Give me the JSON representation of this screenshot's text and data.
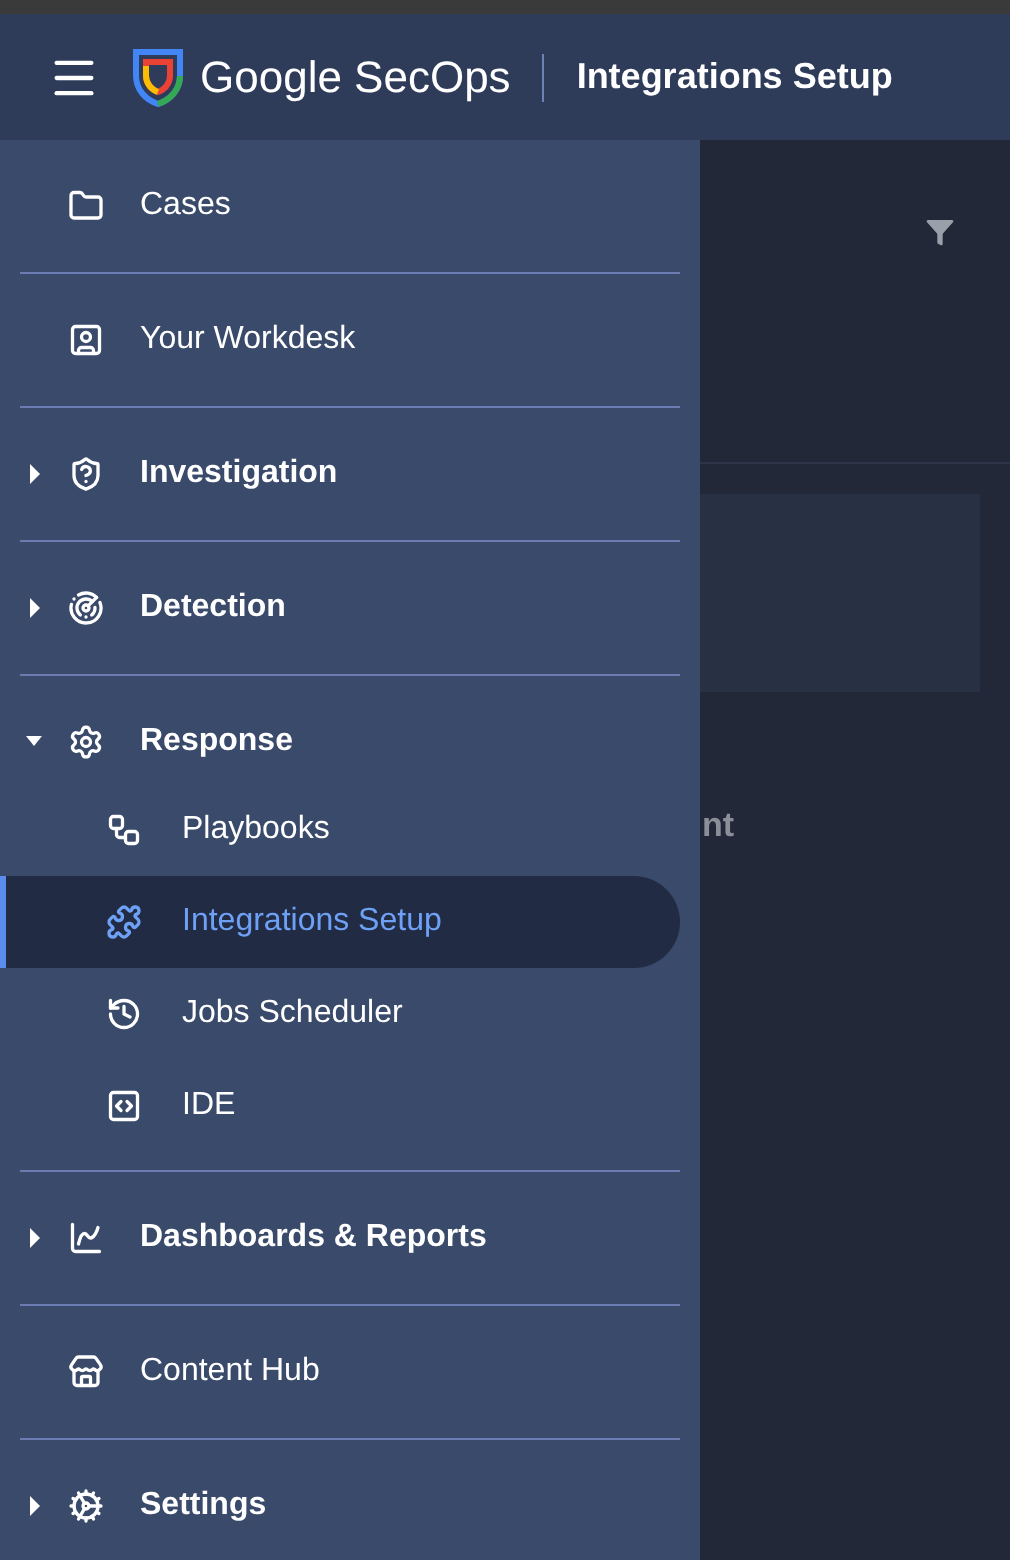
{
  "header": {
    "brand": "Google SecOps",
    "page_title": "Integrations Setup"
  },
  "main": {
    "partial_text": "nt"
  },
  "sidebar": {
    "items": [
      {
        "kind": "link",
        "label": "Cases"
      },
      {
        "kind": "link",
        "label": "Your Workdesk"
      },
      {
        "kind": "group",
        "label": "Investigation",
        "expanded": false
      },
      {
        "kind": "group",
        "label": "Detection",
        "expanded": false
      },
      {
        "kind": "group",
        "label": "Response",
        "expanded": true,
        "children": [
          {
            "label": "Playbooks",
            "selected": false
          },
          {
            "label": "Integrations Setup",
            "selected": true
          },
          {
            "label": "Jobs Scheduler",
            "selected": false
          },
          {
            "label": "IDE",
            "selected": false
          }
        ]
      },
      {
        "kind": "group",
        "label": "Dashboards & Reports",
        "expanded": false
      },
      {
        "kind": "link",
        "label": "Content Hub"
      },
      {
        "kind": "group",
        "label": "Settings",
        "expanded": false
      }
    ]
  }
}
